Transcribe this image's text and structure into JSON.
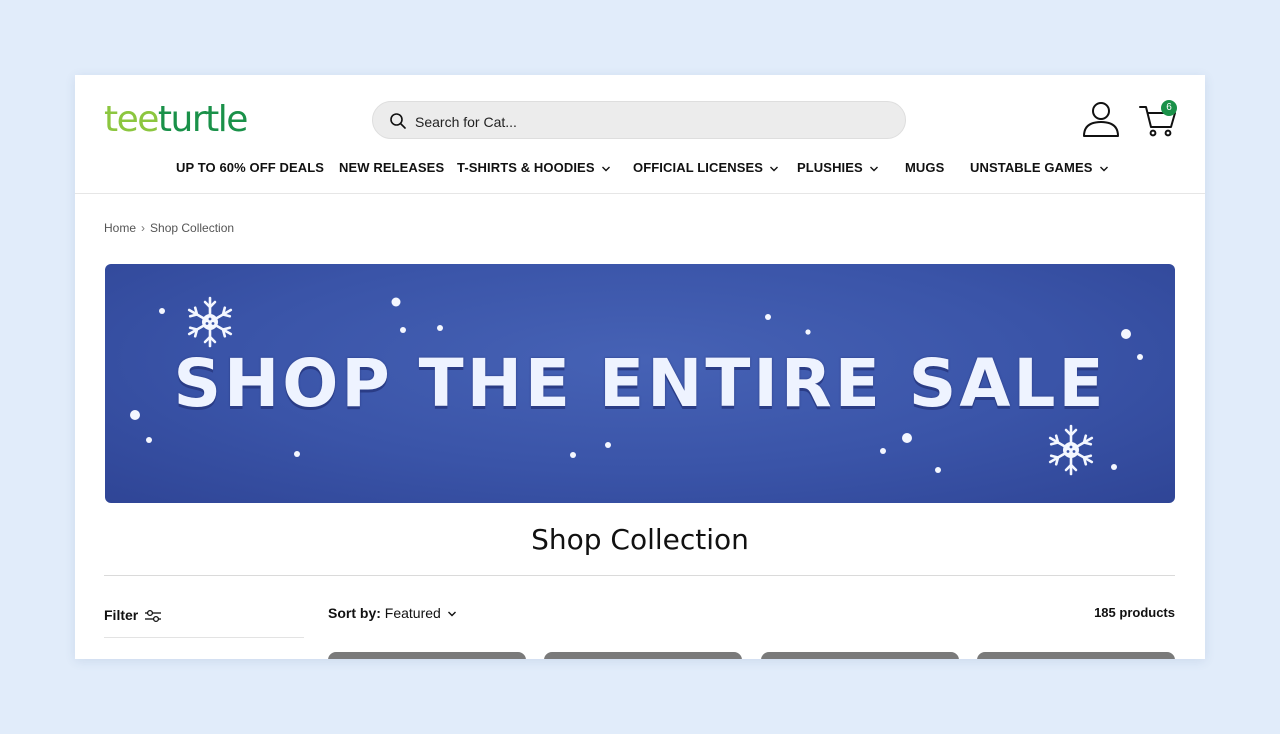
{
  "brand": {
    "logo_part1": "tee",
    "logo_part2": "turtle"
  },
  "search": {
    "placeholder": "Search for Cat..."
  },
  "cart": {
    "count": "6"
  },
  "nav": {
    "deals": "UP TO 60% OFF DEALS",
    "new_releases": "NEW RELEASES",
    "tshirts": "T-SHIRTS & HOODIES",
    "licenses": "OFFICIAL LICENSES",
    "plushies": "PLUSHIES",
    "mugs": "MUGS",
    "games": "UNSTABLE GAMES"
  },
  "breadcrumb": {
    "home": "Home",
    "current": "Shop Collection"
  },
  "banner": {
    "text": "SHOP THE ENTIRE SALE"
  },
  "collection": {
    "title": "Shop Collection"
  },
  "toolbar": {
    "filter_label": "Filter",
    "sort_label": "Sort by:",
    "sort_value": "Featured",
    "product_count": "185 products"
  },
  "colors": {
    "logo_light_green": "#8cc63f",
    "logo_dark_green": "#1a9149",
    "banner_blue": "#3a54a8",
    "page_background": "#e1ecfa"
  },
  "icons": [
    "search-icon",
    "account-icon",
    "cart-icon",
    "chevron-down-icon",
    "filter-icon",
    "snowflake-icon",
    "breadcrumb-chevron-icon"
  ]
}
